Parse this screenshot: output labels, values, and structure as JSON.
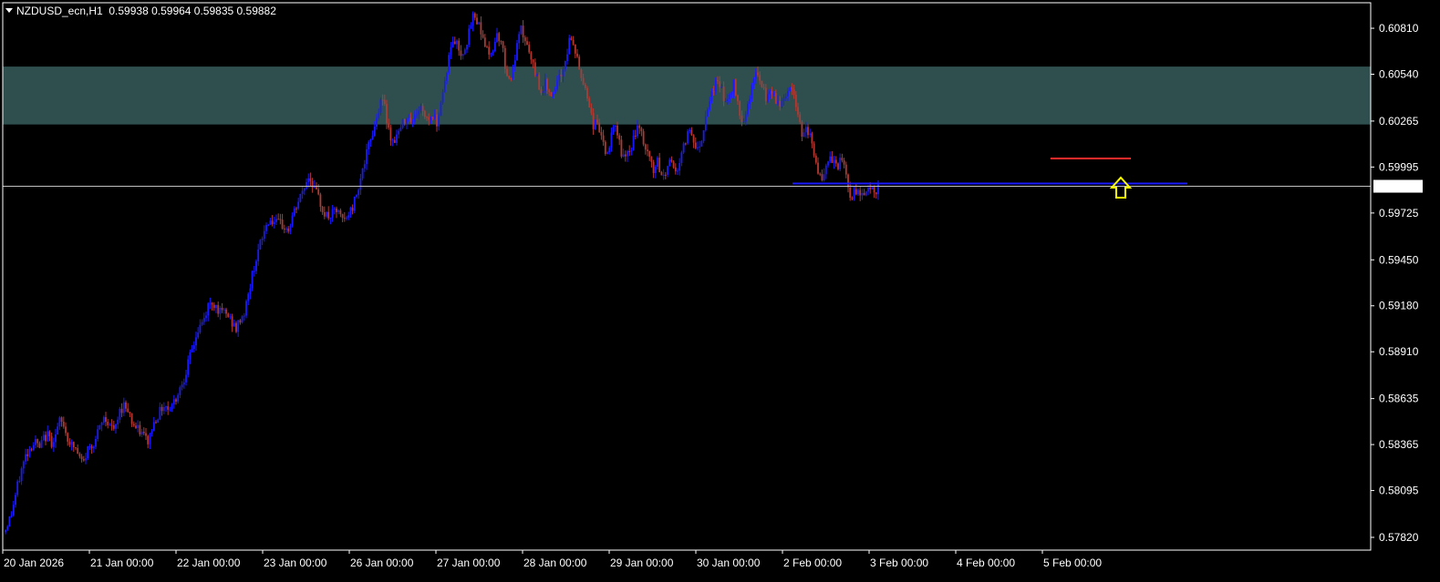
{
  "header": {
    "symbol": "NZDUSD_ecn,H1",
    "ohlc": "0.59938 0.59964 0.59835 0.59882"
  },
  "colors": {
    "background": "#000000",
    "bull": "#1a1aff",
    "bear": "#b03a32",
    "zone": "#2f4f4f",
    "support_line": "#1a1aff",
    "resistance_line": "#ff2a2a",
    "arrow": "#ffff00",
    "current_price_line": "#c0c0c0",
    "axis": "#ffffff"
  },
  "chart_data": {
    "type": "candlestick",
    "instrument": "NZDUSD_ecn",
    "timeframe": "H1",
    "x_tick_labels": [
      "20 Jan 2026",
      "21 Jan 00:00",
      "22 Jan 00:00",
      "23 Jan 00:00",
      "26 Jan 00:00",
      "27 Jan 00:00",
      "28 Jan 00:00",
      "29 Jan 00:00",
      "30 Jan 00:00",
      "2 Feb 00:00",
      "3 Feb 00:00",
      "4 Feb 00:00",
      "5 Feb 00:00"
    ],
    "y_tick_labels": [
      "0.60810",
      "0.60540",
      "0.60265",
      "0.59995",
      "0.59725",
      "0.59450",
      "0.59180",
      "0.58910",
      "0.58635",
      "0.58365",
      "0.58095",
      "0.57820"
    ],
    "y_ticks": [
      0.6081,
      0.6054,
      0.60265,
      0.59995,
      0.59725,
      0.5945,
      0.5918,
      0.5891,
      0.58635,
      0.58365,
      0.58095,
      0.5782
    ],
    "ylim": [
      0.57745,
      0.6096
    ],
    "current_price": 0.59882,
    "current_price_label": "0.59882",
    "zone": {
      "top": 0.60585,
      "bottom": 0.60245
    },
    "support_level": 0.59898,
    "resistance_level": 0.60045,
    "arrow": "up",
    "path": [
      [
        0,
        0.5787
      ],
      [
        3,
        0.5796
      ],
      [
        6,
        0.5812
      ],
      [
        8,
        0.5822
      ],
      [
        10,
        0.583
      ],
      [
        13,
        0.5836
      ],
      [
        15,
        0.5838
      ],
      [
        17,
        0.5834
      ],
      [
        19,
        0.584
      ],
      [
        21,
        0.5842
      ],
      [
        23,
        0.5838
      ],
      [
        25,
        0.5842
      ],
      [
        27,
        0.585
      ],
      [
        29,
        0.5848
      ],
      [
        31,
        0.584
      ],
      [
        33,
        0.5836
      ],
      [
        35,
        0.5834
      ],
      [
        37,
        0.5828
      ],
      [
        39,
        0.5826
      ],
      [
        41,
        0.5834
      ],
      [
        43,
        0.5836
      ],
      [
        45,
        0.584
      ],
      [
        47,
        0.5846
      ],
      [
        49,
        0.5852
      ],
      [
        51,
        0.585
      ],
      [
        53,
        0.5846
      ],
      [
        55,
        0.5846
      ],
      [
        57,
        0.5856
      ],
      [
        59,
        0.586
      ],
      [
        61,
        0.5858
      ],
      [
        63,
        0.585
      ],
      [
        65,
        0.5846
      ],
      [
        67,
        0.5844
      ],
      [
        69,
        0.5842
      ],
      [
        71,
        0.5838
      ],
      [
        73,
        0.5846
      ],
      [
        75,
        0.5852
      ],
      [
        77,
        0.5856
      ],
      [
        79,
        0.586
      ],
      [
        81,
        0.5858
      ],
      [
        83,
        0.586
      ],
      [
        85,
        0.5864
      ],
      [
        87,
        0.587
      ],
      [
        89,
        0.5876
      ],
      [
        91,
        0.5884
      ],
      [
        93,
        0.5892
      ],
      [
        95,
        0.59
      ],
      [
        97,
        0.5906
      ],
      [
        99,
        0.591
      ],
      [
        101,
        0.5918
      ],
      [
        103,
        0.592
      ],
      [
        105,
        0.5918
      ],
      [
        107,
        0.5914
      ],
      [
        109,
        0.5914
      ],
      [
        111,
        0.5912
      ],
      [
        113,
        0.5908
      ],
      [
        115,
        0.5904
      ],
      [
        117,
        0.591
      ],
      [
        119,
        0.5914
      ],
      [
        121,
        0.5924
      ],
      [
        123,
        0.5936
      ],
      [
        125,
        0.5946
      ],
      [
        127,
        0.5954
      ],
      [
        129,
        0.5962
      ],
      [
        131,
        0.5968
      ],
      [
        133,
        0.5968
      ],
      [
        135,
        0.5966
      ],
      [
        137,
        0.5966
      ],
      [
        139,
        0.5964
      ],
      [
        141,
        0.5962
      ],
      [
        143,
        0.597
      ],
      [
        145,
        0.5976
      ],
      [
        147,
        0.5982
      ],
      [
        149,
        0.5988
      ],
      [
        151,
        0.5994
      ],
      [
        153,
        0.599
      ],
      [
        155,
        0.5984
      ],
      [
        157,
        0.5978
      ],
      [
        159,
        0.5972
      ],
      [
        161,
        0.597
      ],
      [
        163,
        0.5972
      ],
      [
        165,
        0.5974
      ],
      [
        167,
        0.597
      ],
      [
        169,
        0.5968
      ],
      [
        171,
        0.5972
      ],
      [
        173,
        0.5976
      ],
      [
        175,
        0.5984
      ],
      [
        177,
        0.5994
      ],
      [
        179,
        0.6002
      ],
      [
        181,
        0.6012
      ],
      [
        183,
        0.602
      ],
      [
        185,
        0.6028
      ],
      [
        187,
        0.604
      ],
      [
        189,
        0.6034
      ],
      [
        191,
        0.6022
      ],
      [
        193,
        0.6014
      ],
      [
        195,
        0.6018
      ],
      [
        197,
        0.6022
      ],
      [
        199,
        0.6028
      ],
      [
        201,
        0.603
      ],
      [
        203,
        0.6026
      ],
      [
        205,
        0.6032
      ],
      [
        207,
        0.6034
      ],
      [
        209,
        0.603
      ],
      [
        211,
        0.6028
      ],
      [
        213,
        0.603
      ],
      [
        215,
        0.6026
      ],
      [
        217,
        0.6038
      ],
      [
        219,
        0.605
      ],
      [
        221,
        0.6064
      ],
      [
        223,
        0.6074
      ],
      [
        225,
        0.6072
      ],
      [
        227,
        0.6066
      ],
      [
        229,
        0.607
      ],
      [
        231,
        0.6078
      ],
      [
        233,
        0.6088
      ],
      [
        235,
        0.6086
      ],
      [
        237,
        0.608
      ],
      [
        239,
        0.6072
      ],
      [
        241,
        0.6064
      ],
      [
        243,
        0.607
      ],
      [
        245,
        0.6078
      ],
      [
        247,
        0.6074
      ],
      [
        249,
        0.606
      ],
      [
        251,
        0.605
      ],
      [
        253,
        0.6056
      ],
      [
        255,
        0.607
      ],
      [
        257,
        0.608
      ],
      [
        259,
        0.6074
      ],
      [
        261,
        0.6066
      ],
      [
        263,
        0.6058
      ],
      [
        265,
        0.6052
      ],
      [
        267,
        0.6044
      ],
      [
        269,
        0.6048
      ],
      [
        271,
        0.6046
      ],
      [
        273,
        0.604
      ],
      [
        275,
        0.6048
      ],
      [
        277,
        0.6054
      ],
      [
        279,
        0.6062
      ],
      [
        281,
        0.6074
      ],
      [
        283,
        0.6072
      ],
      [
        285,
        0.6062
      ],
      [
        287,
        0.6052
      ],
      [
        289,
        0.6046
      ],
      [
        291,
        0.6036
      ],
      [
        293,
        0.6024
      ],
      [
        295,
        0.6026
      ],
      [
        297,
        0.6018
      ],
      [
        299,
        0.6006
      ],
      [
        301,
        0.6012
      ],
      [
        303,
        0.6022
      ],
      [
        305,
        0.602
      ],
      [
        307,
        0.6008
      ],
      [
        309,
        0.6004
      ],
      [
        311,
        0.6008
      ],
      [
        313,
        0.6016
      ],
      [
        315,
        0.6022
      ],
      [
        317,
        0.6018
      ],
      [
        319,
        0.601
      ],
      [
        321,
        0.6004
      ],
      [
        323,
        0.5998
      ],
      [
        325,
        0.6002
      ],
      [
        327,
        0.5994
      ],
      [
        329,
        0.5996
      ],
      [
        331,
        0.6004
      ],
      [
        333,
        0.6
      ],
      [
        335,
        0.5998
      ],
      [
        337,
        0.6006
      ],
      [
        339,
        0.6016
      ],
      [
        341,
        0.6022
      ],
      [
        343,
        0.6016
      ],
      [
        345,
        0.601
      ],
      [
        347,
        0.6016
      ],
      [
        349,
        0.603
      ],
      [
        351,
        0.604
      ],
      [
        353,
        0.6046
      ],
      [
        355,
        0.605
      ],
      [
        357,
        0.6046
      ],
      [
        359,
        0.6036
      ],
      [
        361,
        0.6042
      ],
      [
        363,
        0.6048
      ],
      [
        365,
        0.6038
      ],
      [
        367,
        0.6026
      ],
      [
        369,
        0.6032
      ],
      [
        371,
        0.6042
      ],
      [
        373,
        0.6052
      ],
      [
        375,
        0.6054
      ],
      [
        377,
        0.6046
      ],
      [
        379,
        0.604
      ],
      [
        381,
        0.6044
      ],
      [
        383,
        0.604
      ],
      [
        385,
        0.6036
      ],
      [
        387,
        0.6038
      ],
      [
        389,
        0.6042
      ],
      [
        391,
        0.6046
      ],
      [
        393,
        0.6042
      ],
      [
        395,
        0.603
      ],
      [
        397,
        0.602
      ],
      [
        399,
        0.6024
      ],
      [
        401,
        0.6018
      ],
      [
        403,
        0.6006
      ],
      [
        405,
        0.5998
      ],
      [
        407,
        0.599
      ],
      [
        409,
        0.5998
      ],
      [
        411,
        0.6004
      ],
      [
        413,
        0.6002
      ],
      [
        415,
        0.6
      ],
      [
        417,
        0.6004
      ],
      [
        419,
        0.5994
      ],
      [
        421,
        0.5982
      ],
      [
        423,
        0.5984
      ],
      [
        425,
        0.5986
      ],
      [
        427,
        0.5984
      ],
      [
        429,
        0.5986
      ],
      [
        431,
        0.5988
      ],
      [
        433,
        0.5984
      ],
      [
        435,
        0.5988
      ]
    ]
  }
}
